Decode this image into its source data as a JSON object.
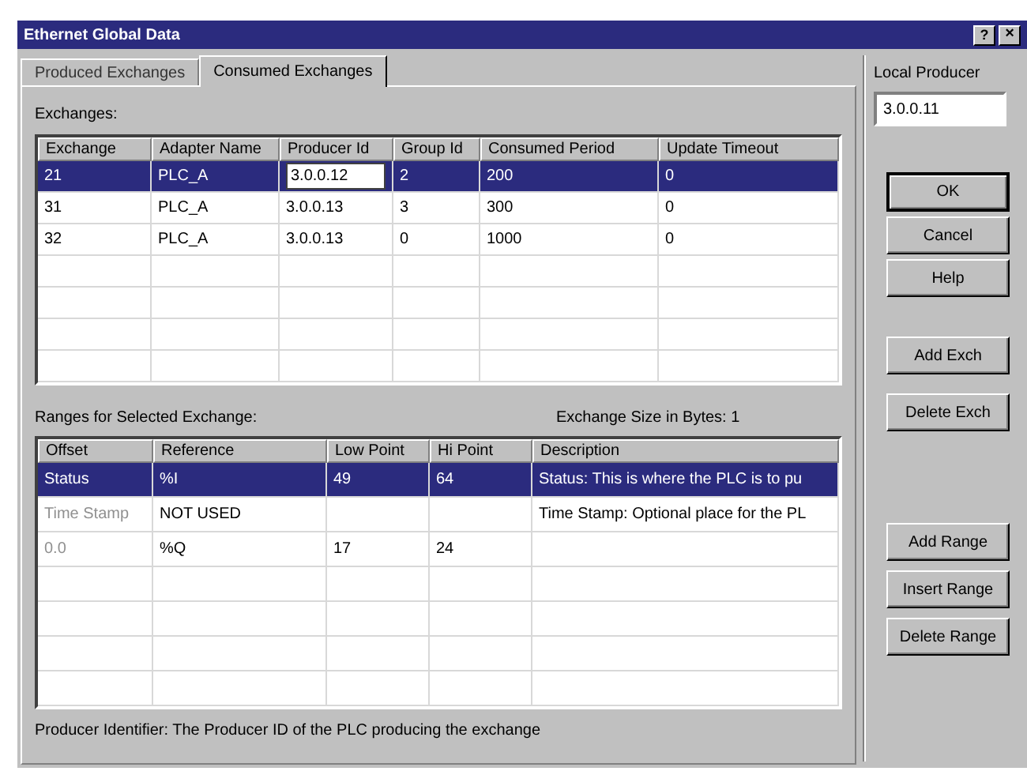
{
  "window": {
    "title": "Ethernet Global Data",
    "help_glyph": "?",
    "close_glyph": "×"
  },
  "tabs": [
    {
      "label": "Produced Exchanges",
      "selected": false
    },
    {
      "label": "Consumed Exchanges",
      "selected": true
    }
  ],
  "exchanges": {
    "label": "Exchanges:",
    "columns": [
      "Exchange",
      "Adapter Name",
      "Producer Id",
      "Group Id",
      "Consumed Period",
      "Update Timeout"
    ],
    "rows": [
      {
        "selected": true,
        "producer_id_editing": true,
        "cells": [
          "21",
          "PLC_A",
          "3.0.0.12",
          "2",
          "200",
          "0"
        ]
      },
      {
        "selected": false,
        "producer_id_editing": false,
        "cells": [
          "31",
          "PLC_A",
          "3.0.0.13",
          "3",
          "300",
          "0"
        ]
      },
      {
        "selected": false,
        "producer_id_editing": false,
        "cells": [
          "32",
          "PLC_A",
          "3.0.0.13",
          "0",
          "1000",
          "0"
        ]
      }
    ]
  },
  "ranges": {
    "label": "Ranges for Selected Exchange:",
    "size_label": "Exchange Size in Bytes: 1",
    "columns": [
      "Offset",
      "Reference",
      "Low Point",
      "Hi Point",
      "Description"
    ],
    "rows": [
      {
        "selected": true,
        "offset_disabled": false,
        "cells": [
          "Status",
          "%I",
          "49",
          "64",
          "Status: This is where the PLC is to pu"
        ]
      },
      {
        "selected": false,
        "offset_disabled": true,
        "cells": [
          "Time Stamp",
          "NOT USED",
          "",
          "",
          "Time Stamp: Optional place for the PL"
        ]
      },
      {
        "selected": false,
        "offset_disabled": true,
        "cells": [
          "0.0",
          "%Q",
          "17",
          "24",
          ""
        ]
      }
    ]
  },
  "status_text": "Producer Identifier: The Producer ID of the PLC producing the exchange",
  "local_producer": {
    "label": "Local Producer",
    "value": "3.0.0.11"
  },
  "buttons": [
    {
      "label": "OK",
      "default": true
    },
    {
      "label": "Cancel",
      "default": false
    },
    {
      "label": "Help",
      "default": false
    },
    {
      "label": "Add Exch",
      "default": false
    },
    {
      "label": "Delete Exch",
      "default": false
    },
    {
      "label": "Add Range",
      "default": false
    },
    {
      "label": "Insert Range",
      "default": false
    },
    {
      "label": "Delete Range",
      "default": false
    }
  ]
}
